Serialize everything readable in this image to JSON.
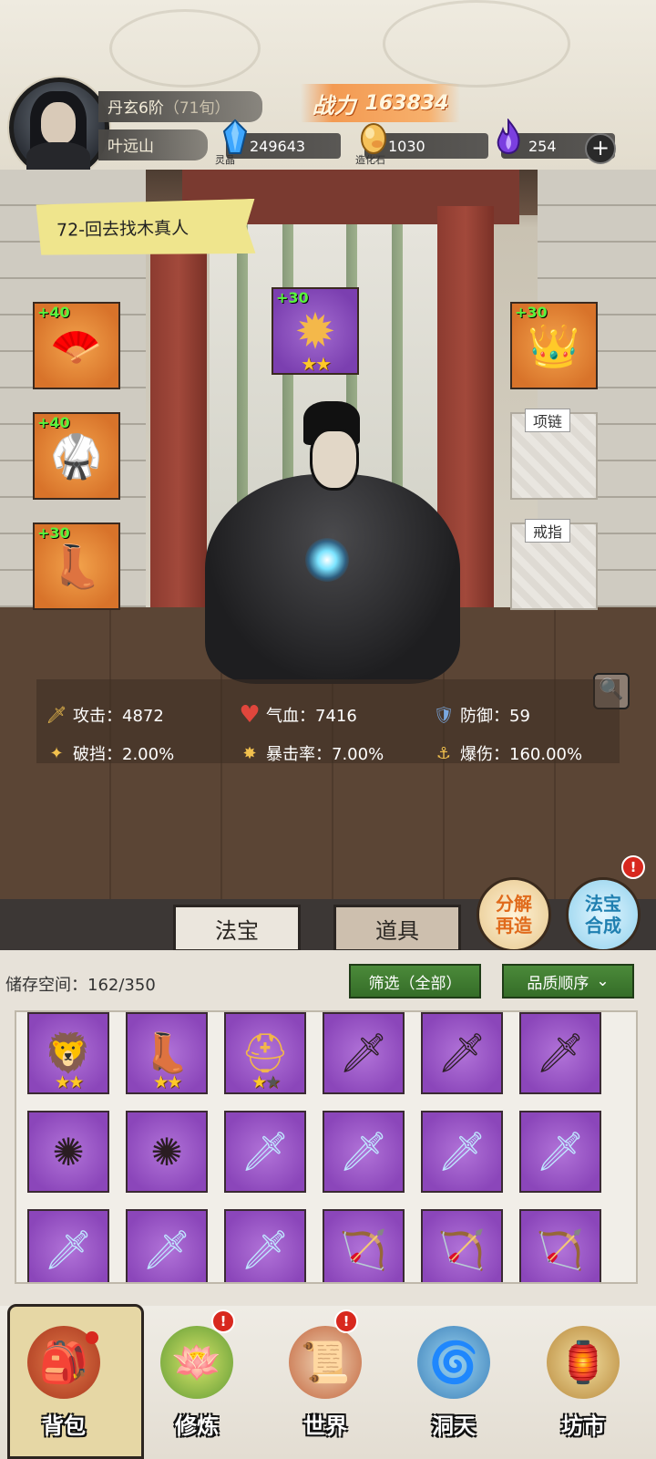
{
  "header": {
    "rank": "丹玄6阶",
    "age": "（71旬）",
    "player_name": "叶远山",
    "power_label": "战力",
    "power_value": "163834",
    "resources": [
      {
        "name": "灵晶",
        "value": "249643",
        "icon": "blue-crystal-icon"
      },
      {
        "name": "造化石",
        "value": "1030",
        "icon": "gold-stone-icon"
      },
      {
        "name": "",
        "value": "254",
        "icon": "purple-flame-icon"
      }
    ],
    "plus_label": "+"
  },
  "quest": {
    "label": "72-回去找木真人"
  },
  "equipment": {
    "left": [
      {
        "plus": "+40",
        "icon": "jade-fan-icon",
        "glyph": "🪭"
      },
      {
        "plus": "+40",
        "icon": "dark-robe-icon",
        "glyph": "🥋"
      },
      {
        "plus": "+30",
        "icon": "dark-boots-icon",
        "glyph": "👢"
      }
    ],
    "center": {
      "plus": "+30",
      "icon": "golden-amulet-icon",
      "glyph": "✹",
      "stars": "★★"
    },
    "right_top": {
      "plus": "+30",
      "icon": "golden-crown-icon",
      "glyph": "👑"
    },
    "necklace_label": "项链",
    "ring_label": "戒指"
  },
  "stats": [
    {
      "label": "攻击：4872",
      "icon": "sword-icon",
      "glyph": "🗡",
      "color": "#f2c14e"
    },
    {
      "label": "气血：7416",
      "icon": "heart-icon",
      "glyph": "♥",
      "color": "#e0463c"
    },
    {
      "label": "防御：59",
      "icon": "shield-icon",
      "glyph": "🛡",
      "color": "#7aa8e0"
    },
    {
      "label": "破挡：2.00%",
      "icon": "break-icon",
      "glyph": "✦",
      "color": "#f2c14e"
    },
    {
      "label": "暴击率：7.00%",
      "icon": "crit-icon",
      "glyph": "✸",
      "color": "#f2c14e"
    },
    {
      "label": "爆伤：160.00%",
      "icon": "crit-damage-icon",
      "glyph": "⚓",
      "color": "#f2c14e"
    }
  ],
  "actions": {
    "decompose_line1": "分解",
    "decompose_line2": "再造",
    "compose_line1": "法宝",
    "compose_line2": "合成",
    "compose_badge": "!"
  },
  "tabs": {
    "fabao": "法宝",
    "items": "道具"
  },
  "inventory": {
    "storage_label": "储存空间：162/350",
    "filter_label": "筛选（全部）",
    "sort_label": "品质顺序",
    "sort_caret": "⌄",
    "cells": [
      {
        "icon": "golden-armor-icon",
        "glyph": "🦁",
        "stars": 2,
        "max_stars": 2
      },
      {
        "icon": "dark-boots-icon",
        "glyph": "👢",
        "stars": 2,
        "max_stars": 2
      },
      {
        "icon": "golden-helmet-icon",
        "glyph": "⛑",
        "stars": 1,
        "max_stars": 2
      },
      {
        "icon": "dark-blade-icon",
        "glyph": "🗡",
        "stars": 0,
        "max_stars": 0
      },
      {
        "icon": "dark-blade-icon",
        "glyph": "🗡",
        "stars": 0,
        "max_stars": 0
      },
      {
        "icon": "dark-blade-icon",
        "glyph": "🗡",
        "stars": 0,
        "max_stars": 0
      },
      {
        "icon": "spiked-wheel-icon",
        "glyph": "✺",
        "stars": 0,
        "max_stars": 0
      },
      {
        "icon": "spiked-wheel-icon",
        "glyph": "✺",
        "stars": 0,
        "max_stars": 0
      },
      {
        "icon": "ice-sword-icon",
        "glyph": "🗡",
        "stars": 0,
        "max_stars": 0
      },
      {
        "icon": "ice-sword-icon",
        "glyph": "🗡",
        "stars": 0,
        "max_stars": 0
      },
      {
        "icon": "ice-sword-icon",
        "glyph": "🗡",
        "stars": 0,
        "max_stars": 0
      },
      {
        "icon": "ice-sword-icon",
        "glyph": "🗡",
        "stars": 0,
        "max_stars": 0
      },
      {
        "icon": "ice-sword-icon",
        "glyph": "🗡",
        "stars": 0,
        "max_stars": 0
      },
      {
        "icon": "ice-sword-icon",
        "glyph": "🗡",
        "stars": 0,
        "max_stars": 0
      },
      {
        "icon": "ice-sword-icon",
        "glyph": "🗡",
        "stars": 0,
        "max_stars": 0
      },
      {
        "icon": "ice-bow-icon",
        "glyph": "🏹",
        "stars": 0,
        "max_stars": 0
      },
      {
        "icon": "ice-bow-icon",
        "glyph": "🏹",
        "stars": 0,
        "max_stars": 0
      },
      {
        "icon": "ice-bow-icon",
        "glyph": "🏹",
        "stars": 0,
        "max_stars": 0
      }
    ]
  },
  "nav": [
    {
      "label": "背包",
      "icon": "bag-icon",
      "glyph": "🎒",
      "badge": "",
      "active": true
    },
    {
      "label": "修炼",
      "icon": "lotus-icon",
      "glyph": "🪷",
      "badge": "!",
      "active": false
    },
    {
      "label": "世界",
      "icon": "scroll-map-icon",
      "glyph": "📜",
      "badge": "!",
      "active": false
    },
    {
      "label": "洞天",
      "icon": "portal-icon",
      "glyph": "🌀",
      "badge": "",
      "active": false
    },
    {
      "label": "坊市",
      "icon": "market-icon",
      "glyph": "🏮",
      "badge": "",
      "active": false
    }
  ],
  "colors": {
    "accent_orange": "#f39a52",
    "item_purple": "#8b46ba",
    "item_orange": "#d8732a",
    "green_button": "#4b8a3a",
    "badge_red": "#d8281e"
  }
}
